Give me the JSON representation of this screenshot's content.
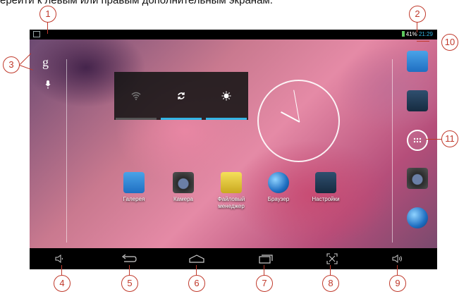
{
  "caption": "ерейти к левым или правым дополнительным экранам.",
  "status_bar": {
    "battery": "41%",
    "time": "21:29"
  },
  "search": {
    "google_glyph": "g"
  },
  "quick_settings": [
    {
      "icon": "wifi-icon",
      "active": false
    },
    {
      "icon": "sync-icon",
      "active": true
    },
    {
      "icon": "brightness-icon",
      "active": true
    }
  ],
  "apps": [
    {
      "label": "Галерея",
      "icon": "gallery-icon"
    },
    {
      "label": "Камера",
      "icon": "camera-icon"
    },
    {
      "label": "Файловый менеджер",
      "icon": "file-manager-icon"
    },
    {
      "label": "Браузер",
      "icon": "browser-icon"
    },
    {
      "label": "Настройки",
      "icon": "settings-icon"
    }
  ],
  "dock": [
    "gallery-icon",
    "settings-icon",
    "all-apps-icon",
    "camera-icon",
    "browser-icon"
  ],
  "nav": [
    "volume-down-icon",
    "back-icon",
    "home-icon",
    "recents-icon",
    "screenshot-icon",
    "volume-up-icon"
  ],
  "callouts": [
    "1",
    "2",
    "3",
    "4",
    "5",
    "6",
    "7",
    "8",
    "9",
    "10",
    "11"
  ],
  "colors": {
    "accent": "#33b5e5",
    "callout": "#c0392b"
  }
}
